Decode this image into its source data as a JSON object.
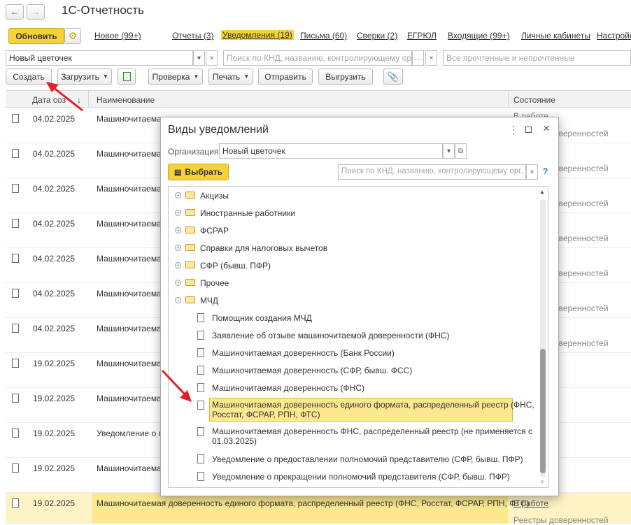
{
  "window": {
    "title": "1С-Отчетность"
  },
  "toolbar1": {
    "refresh_label": "Обновить"
  },
  "nav_tabs": [
    "Новое (99+)",
    "Отчеты (3)",
    "Уведомления (19)",
    "Письма (60)",
    "Сверки (2)",
    "ЕГРЮЛ",
    "Входящие (99+)",
    "Личные кабинеты",
    "Настройк"
  ],
  "filters": {
    "org_value": "Новый цветочек",
    "search_placeholder": "Поиск по КНД, названию, контролирующему орг...",
    "status_placeholder": "Все прочтенные и непрочтенные"
  },
  "toolbar2": {
    "create": "Создать",
    "load": "Загрузить",
    "check": "Проверка",
    "print": "Печать",
    "send": "Отправить",
    "export": "Выгрузить"
  },
  "table": {
    "headers": {
      "date": "Дата соз",
      "sort": "↓",
      "name": "Наименование",
      "state": "Состояние"
    },
    "rows": [
      {
        "date": "04.02.2025",
        "name": "Машиночитаемая",
        "state_top": "В работе",
        "state": "Реестры доверенностей"
      },
      {
        "date": "04.02.2025",
        "name": "Машиночитаемая",
        "state": "Реестры доверенностей"
      },
      {
        "date": "04.02.2025",
        "name": "Машиночитаемая",
        "state": "Реестры доверенностей"
      },
      {
        "date": "04.02.2025",
        "name": "Машиночитаемая",
        "state": "Реестры доверенностей"
      },
      {
        "date": "04.02.2025",
        "name": "Машиночитаемая",
        "state": "Реестры доверенностей"
      },
      {
        "date": "04.02.2025",
        "name": "Машиночитаемая",
        "state": "Реестры доверенностей"
      },
      {
        "date": "04.02.2025",
        "name": "Машиночитаемая",
        "state": "Реестры доверенностей"
      },
      {
        "date": "19.02.2025",
        "name": "Машиночитаемая",
        "state": ""
      },
      {
        "date": "19.02.2025",
        "name": "Машиночитаемая",
        "state": ""
      },
      {
        "date": "19.02.2025",
        "name": "Уведомление о пр",
        "state": ""
      },
      {
        "date": "19.02.2025",
        "name": "Машиночитаемая",
        "state": ""
      }
    ],
    "last_row": {
      "date": "19.02.2025",
      "name": "Машиночитаемая доверенность единого формата, распределенный реестр (ФНС, Росстат, ФСРАР, РПН, ФТС)",
      "state_link": "В работе",
      "state": "Реестры доверенностей"
    }
  },
  "dialog": {
    "title": "Виды уведомлений",
    "org_label": "Организация:",
    "org_value": "Новый цветочек",
    "choose_label": "Выбрать",
    "search_placeholder": "Поиск по КНД, названию, контролирующему орг...",
    "help": "?",
    "folders": [
      "Акцизы",
      "Иностранные работники",
      "ФСРАР",
      "Справки для налоговых вычетов",
      "СФР (бывш. ПФР)",
      "Прочее",
      "МЧД"
    ],
    "items": [
      "Помощник создания МЧД",
      "Заявление об отзыве машиночитаемой доверенности (ФНС)",
      "Машиночитаемая доверенность (Банк России)",
      "Машиночитаемая доверенность (СФР, бывш. ФСС)",
      "Машиночитаемая доверенность (ФНС)",
      "Машиночитаемая доверенность единого формата, распределенный реестр (ФНС,",
      "Росстат, ФСРАР, РПН, ФТС)",
      "Машиночитаемая доверенность ФНС, распределенный реестр (не применяется с",
      "01.03.2025)",
      "Уведомление о предоставлении полномочий представителю (СФР, бывш. ПФР)",
      "Уведомление о прекращении полномочий представителя (СФР, бывш. ПФР)"
    ]
  },
  "colors": {
    "accent_yellow": "#f5d23a",
    "selected": "#fbe88f",
    "arrow": "#e0202a"
  }
}
